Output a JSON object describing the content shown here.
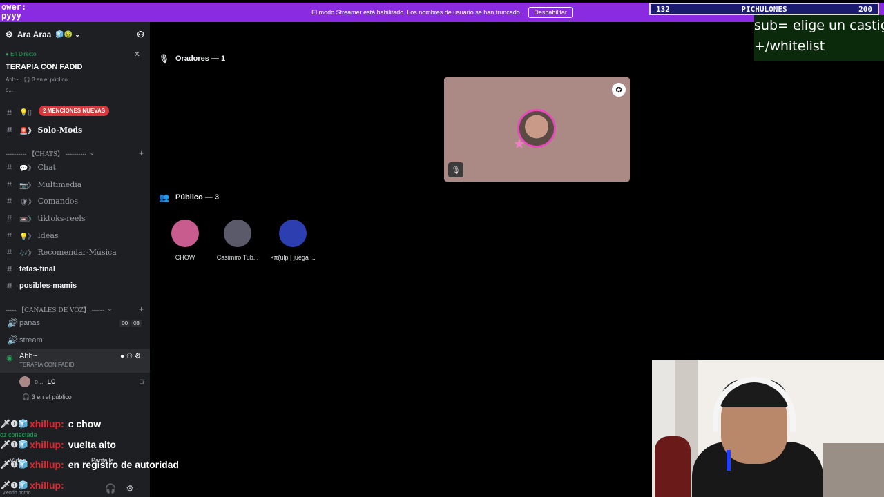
{
  "top_overlay": {
    "logo_text": "ower:\npyyy",
    "banner_text": "El modo Streamer está habilitado. Los nombres de usuario se han truncado.",
    "banner_button": "Deshabilitar",
    "counter_current": "132",
    "counter_label": "PICHULONES",
    "counter_goal": "200",
    "sub_text_line1": "sub= elige un castigo",
    "sub_text_line2": "+/whitelist"
  },
  "server": {
    "name": "Ara Araa"
  },
  "live": {
    "tag": "En Directo",
    "title": "TERAPIA CON FADID",
    "meta": "Ahh~ · 🎧 3 en el público",
    "meta2": "o..."
  },
  "mention_badge": "2 MENCIONES NUEVAS",
  "channels": {
    "solo_mods": "Solo-Mods",
    "cat_chats": "---------- 【CHATS】 ----------",
    "chat": "Chat",
    "multimedia": "Multimedia",
    "comandos": "Comandos",
    "tiktoks": "tiktoks-reels",
    "ideas": "Ideas",
    "recomendar": "Recomendar-Música",
    "tetas": "tetas-final",
    "posibles": "posibles-mamis",
    "cat_voz": "----- 【CANALES DE VOZ】 ------",
    "panas": "panas",
    "panas_count_a": "00",
    "panas_count_b": "08",
    "stream": "stream"
  },
  "active_voice": {
    "name": "Ahh~",
    "subtitle": "TERAPIA CON FADID",
    "user_name": "o...",
    "user_tag": "LC",
    "audience": "3 en el público"
  },
  "stage": {
    "speakers_header": "Oradores — 1",
    "audience_header": "Público — 3",
    "audience": [
      {
        "name": "CHOW",
        "color": "#c85c8e"
      },
      {
        "name": "Casimiro Tub...",
        "color": "#5a5a6a"
      },
      {
        "name": "×π(ulp | juega ...",
        "color": "#2d3fb0"
      }
    ]
  },
  "chat_overlay": [
    {
      "user": "xhillup:",
      "msg": "c chow"
    },
    {
      "user": "xhillup:",
      "msg": "vuelta alto"
    },
    {
      "user": "xhillup:",
      "msg": "en registro de autoridad"
    },
    {
      "user": "xhillup:",
      "msg": ""
    }
  ],
  "under_chat": {
    "connected": "oz conectada",
    "video": "Vídeo",
    "screen": "Pantalla",
    "viewing": "viendo porno"
  },
  "colors": {
    "banner": "#8a2be2",
    "mention": "#da373c",
    "live": "#23a55a",
    "username": "#e8242c"
  }
}
